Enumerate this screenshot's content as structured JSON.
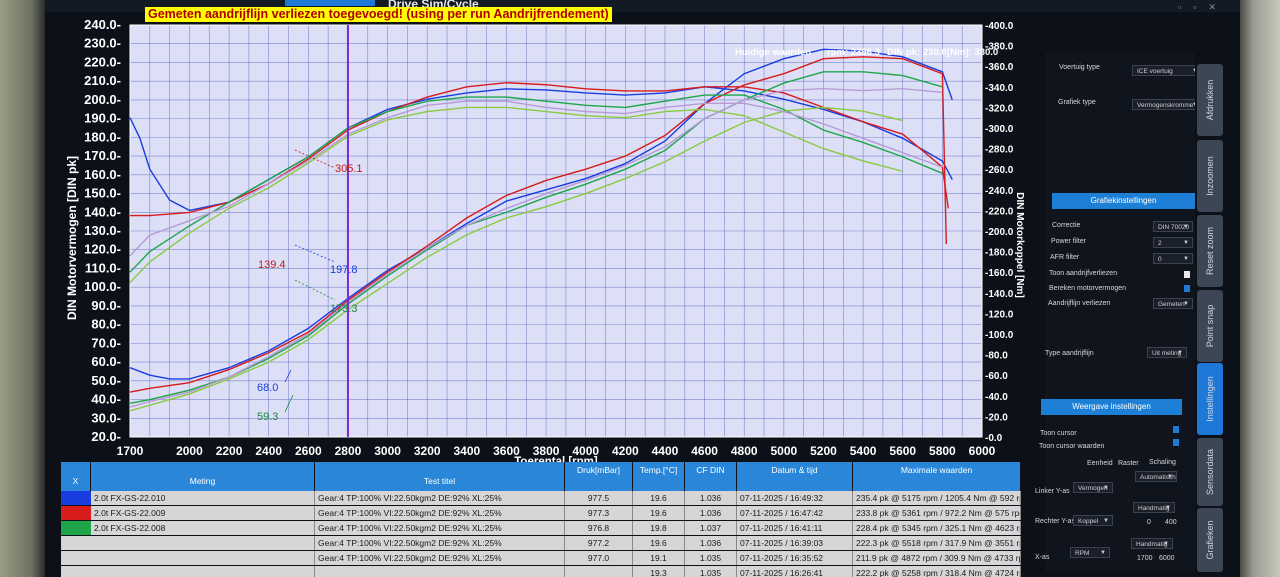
{
  "app": {
    "title": "Drive Sim/Cycle"
  },
  "banner": "Gemeten aandrijflijn verliezen toegevoegd! (using per run Aandrijfrendement)",
  "readout": {
    "label": "Huidige waarden",
    "rpm": "rpm: 2396.3",
    "din": "DIN pk: 230.0",
    "nm": "[Nm]: 330.0"
  },
  "chart_data": {
    "type": "line",
    "xlabel": "Toerental [rpm]",
    "ylabel": "DIN Motorvermogen [DIN pk]",
    "y2label": "DIN Motorkoppel [Nm]",
    "xlim": [
      1700,
      6000
    ],
    "ylim": [
      20,
      240
    ],
    "y2lim": [
      0,
      400
    ],
    "x_ticks": [
      "1700",
      "2000",
      "2200",
      "2400",
      "2600",
      "2800",
      "3000",
      "3200",
      "3400",
      "3600",
      "3800",
      "4000",
      "4200",
      "4400",
      "4600",
      "4800",
      "5000",
      "5200",
      "5400",
      "5600",
      "5800",
      "6000"
    ],
    "y_ticks": [
      "240.0",
      "230.0",
      "220.0",
      "210.0",
      "200.0",
      "190.0",
      "180.0",
      "170.0",
      "160.0",
      "150.0",
      "140.0",
      "130.0",
      "120.0",
      "110.0",
      "100.0",
      "90.0",
      "80.0",
      "70.0",
      "60.0",
      "50.0",
      "40.0",
      "30.0",
      "20.0"
    ],
    "y2_ticks": [
      "400.0",
      "380.0",
      "360.0",
      "340.0",
      "320.0",
      "300.0",
      "280.0",
      "260.0",
      "240.0",
      "220.0",
      "200.0",
      "180.0",
      "160.0",
      "140.0",
      "120.0",
      "100.0",
      "80.0",
      "60.0",
      "40.0",
      "20.0",
      "0.0"
    ],
    "cursor_x": 2800,
    "annotations": [
      "305.1",
      "139.4",
      "197.8",
      "173.3",
      "68.0",
      "59.3"
    ],
    "series": [
      {
        "color": "#1a3de0",
        "power_x": [
          1700,
          1800,
          1900,
          2000,
          2200,
          2400,
          2600,
          2800,
          3000,
          3200,
          3400,
          3600,
          3800,
          4000,
          4200,
          4400,
          4600,
          4800,
          5000,
          5200,
          5400,
          5600,
          5800,
          5850
        ],
        "power": [
          57,
          53,
          51,
          51,
          57,
          66,
          78,
          94,
          109,
          121,
          134,
          146,
          152,
          158,
          166,
          178,
          198,
          214,
          222,
          227,
          226,
          223,
          215,
          200
        ],
        "torque_x": [
          1700,
          1750,
          1800,
          1900,
          2000,
          2200,
          2400,
          2600,
          2800,
          3000,
          3200,
          3400,
          3600,
          3800,
          4000,
          4200,
          4400,
          4600,
          4800,
          5000,
          5200,
          5400,
          5600,
          5800,
          5850
        ],
        "torque": [
          310,
          290,
          260,
          230,
          220,
          228,
          250,
          272,
          300,
          318,
          328,
          334,
          338,
          337,
          334,
          332,
          334,
          340,
          336,
          328,
          318,
          306,
          290,
          268,
          250
        ]
      },
      {
        "color": "#d81b1b",
        "power_x": [
          1700,
          1800,
          2000,
          2200,
          2400,
          2600,
          2800,
          3000,
          3200,
          3400,
          3600,
          3800,
          4000,
          4200,
          4400,
          4600,
          4800,
          5000,
          5200,
          5400,
          5600,
          5800,
          5820
        ],
        "power": [
          44,
          46,
          49,
          56,
          65,
          76,
          93,
          108,
          122,
          137,
          149,
          157,
          163,
          170,
          181,
          198,
          208,
          214,
          222,
          223,
          222,
          214,
          123
        ],
        "torque_x": [
          1700,
          1800,
          2000,
          2200,
          2400,
          2600,
          2800,
          3000,
          3200,
          3400,
          3600,
          3800,
          4000,
          4200,
          4400,
          4600,
          4800,
          5000,
          5200,
          5400,
          5600,
          5800,
          5830
        ],
        "torque": [
          215,
          215,
          218,
          228,
          246,
          270,
          298,
          316,
          330,
          340,
          344,
          342,
          338,
          336,
          336,
          340,
          340,
          334,
          320,
          306,
          294,
          262,
          222
        ]
      },
      {
        "color": "#1fa64a",
        "power_x": [
          1700,
          1800,
          2000,
          2200,
          2400,
          2600,
          2800,
          3000,
          3200,
          3400,
          3600,
          3800,
          4000,
          4200,
          4400,
          4600,
          4800,
          5000,
          5200,
          5400,
          5600,
          5800
        ],
        "power": [
          38,
          40,
          45,
          52,
          62,
          74,
          91,
          106,
          120,
          133,
          140,
          148,
          155,
          163,
          173,
          190,
          200,
          209,
          215,
          215,
          213,
          207
        ],
        "torque_x": [
          1700,
          1800,
          2000,
          2200,
          2400,
          2600,
          2800,
          3000,
          3200,
          3400,
          3600,
          3800,
          4000,
          4200,
          4400,
          4600,
          4800,
          5000,
          5200,
          5400,
          5600,
          5800
        ],
        "torque": [
          160,
          180,
          205,
          228,
          250,
          272,
          300,
          316,
          326,
          330,
          330,
          326,
          322,
          320,
          326,
          332,
          332,
          318,
          298,
          286,
          272,
          256
        ]
      },
      {
        "color": "#8aca40",
        "power_x": [
          1700,
          1800,
          2000,
          2200,
          2400,
          2600,
          2800,
          3000,
          3200,
          3400,
          3600,
          3800,
          4000,
          4200,
          4400,
          4600,
          4800,
          5000,
          5200,
          5400,
          5600
        ],
        "power": [
          34,
          37,
          43,
          51,
          60,
          72,
          88,
          102,
          116,
          128,
          137,
          143,
          150,
          158,
          167,
          178,
          188,
          194,
          196,
          194,
          189
        ],
        "torque_x": [
          1700,
          1800,
          2000,
          2200,
          2400,
          2600,
          2800,
          3000,
          3200,
          3400,
          3600,
          3800,
          4000,
          4200,
          4400,
          4600,
          4800,
          5000,
          5200,
          5400,
          5600
        ],
        "torque": [
          150,
          170,
          198,
          222,
          242,
          266,
          292,
          308,
          316,
          320,
          320,
          316,
          312,
          310,
          316,
          318,
          312,
          296,
          280,
          268,
          258
        ]
      },
      {
        "color": "#b79ad6",
        "power_x": [
          1700,
          1800,
          2000,
          2200,
          2400,
          2600,
          2800,
          3000,
          3200,
          3400,
          3600,
          3800,
          4000,
          4200,
          4400,
          4600,
          4800,
          5000,
          5200,
          5400,
          5600,
          5800
        ],
        "power": [
          36,
          39,
          44,
          52,
          63,
          75,
          92,
          107,
          121,
          133,
          142,
          150,
          157,
          165,
          175,
          190,
          200,
          205,
          206,
          205,
          206,
          204
        ],
        "torque_x": [
          1700,
          1800,
          2000,
          2200,
          2400,
          2600,
          2800,
          3000,
          3200,
          3400,
          3600,
          3800,
          4000,
          4200,
          4400,
          4600,
          4800,
          5000,
          5200,
          5400,
          5600,
          5800
        ],
        "torque": [
          176,
          196,
          210,
          224,
          246,
          268,
          294,
          310,
          322,
          326,
          326,
          320,
          316,
          314,
          320,
          324,
          324,
          316,
          304,
          290,
          276,
          262
        ]
      }
    ]
  },
  "panel": {
    "voertuig_type_label": "Voertuig type",
    "voertuig_type_value": "ICE voertuig",
    "grafiek_type_label": "Grafiek type",
    "grafiek_type_value": "Vermogenskromme",
    "grafiek_instellingen": "Grafiekinstellingen",
    "correctie_label": "Correctie",
    "correctie_value": "DIN 70020",
    "power_filter_label": "Power filter",
    "power_filter_value": "2",
    "afr_filter_label": "AFR filter",
    "afr_filter_value": "0",
    "toon_aandrijf": "Toon aandrijfverliezen",
    "bereken_motor": "Bereken motorvermogen",
    "aandrijf_verliezen_label": "Aandrijflijn verliezen",
    "aandrijf_verliezen_value": "Gemeten",
    "type_aandrijflijn_label": "Type aandrijflijn",
    "type_aandrijflijn_value": "Uit meting",
    "weergave": "Weergave instellingen",
    "toon_cursor": "Toon cursor",
    "toon_cursor_waarden": "Toon cursor waarden",
    "eenheid": "Eenheid",
    "raster": "Raster",
    "schaling": "Schaling",
    "linker_label": "Linker Y-as",
    "linker_value": "Vermogen",
    "linker_scale": "Automatisch",
    "rechter_label": "Rechter Y-as",
    "rechter_value": "Koppel",
    "rechter_scale": "Handmatig",
    "rechter_min": "0",
    "rechter_max": "400",
    "xas_label": "X-as",
    "xas_value": "RPM",
    "xas_scale": "Handmatig",
    "xas_min": "1700",
    "xas_max": "6000"
  },
  "side_tabs": [
    "Afdrukken",
    "Inzoomen",
    "Reset zoom",
    "Point snap",
    "Instellingen",
    "Sensordata",
    "Grafieken"
  ],
  "table": {
    "headers": [
      "X",
      "Meting",
      "Test titel",
      "Druk[mBar]",
      "Temp.[°C]",
      "CF DIN",
      "Datum & tijd",
      "Maximale waarden"
    ],
    "rows": [
      {
        "color": "#1a3de0",
        "meting": "2.0t FX-GS-22.010",
        "titel": "Gear:4 TP:100% VI:22.50kgm2 DE:92% XL:25%",
        "druk": "977.5",
        "temp": "19.6",
        "cf": "1.036",
        "datum": "07-11-2025 / 16:49:32",
        "max": "235.4 pk @ 5175 rpm / 1205.4 Nm @ 592 rp"
      },
      {
        "color": "#d81b1b",
        "meting": "2.0t FX-GS-22.009",
        "titel": "Gear:4 TP:100% VI:22.50kgm2 DE:92% XL:25%",
        "druk": "977.3",
        "temp": "19.6",
        "cf": "1.036",
        "datum": "07-11-2025 / 16:47:42",
        "max": "233.8 pk @ 5361 rpm / 972.2 Nm @ 575 rpm"
      },
      {
        "color": "#1fa64a",
        "meting": "2.0t FX-GS-22.008",
        "titel": "Gear:4 TP:100% VI:22.50kgm2 DE:92% XL:25%",
        "druk": "976.8",
        "temp": "19.8",
        "cf": "1.037",
        "datum": "07-11-2025 / 16:41:11",
        "max": "228.4 pk @ 5345 rpm / 325.1 Nm @ 4623 rp"
      },
      {
        "color": "#d6d6d6",
        "meting": "",
        "titel": "Gear:4 TP:100% VI:22.50kgm2 DE:92% XL:25%",
        "druk": "977.2",
        "temp": "19.6",
        "cf": "1.036",
        "datum": "07-11-2025 / 16:39:03",
        "max": "222.3 pk @ 5518 rpm / 317.9 Nm @ 3551 rpr"
      },
      {
        "color": "#d6d6d6",
        "meting": "",
        "titel": "Gear:4 TP:100% VI:22.50kgm2 DE:92% XL:25%",
        "druk": "977.0",
        "temp": "19.1",
        "cf": "1.035",
        "datum": "07-11-2025 / 16:35:52",
        "max": "211.9 pk @ 4872 rpm / 309.9 Nm @ 4733 rp"
      },
      {
        "color": "#d6d6d6",
        "meting": "",
        "titel": "",
        "druk": "",
        "temp": "19.3",
        "cf": "1.035",
        "datum": "07-11-2025 / 16:26:41",
        "max": "222.2 pk @ 5258 rpm / 318.4 Nm @ 4724 rp"
      }
    ]
  }
}
